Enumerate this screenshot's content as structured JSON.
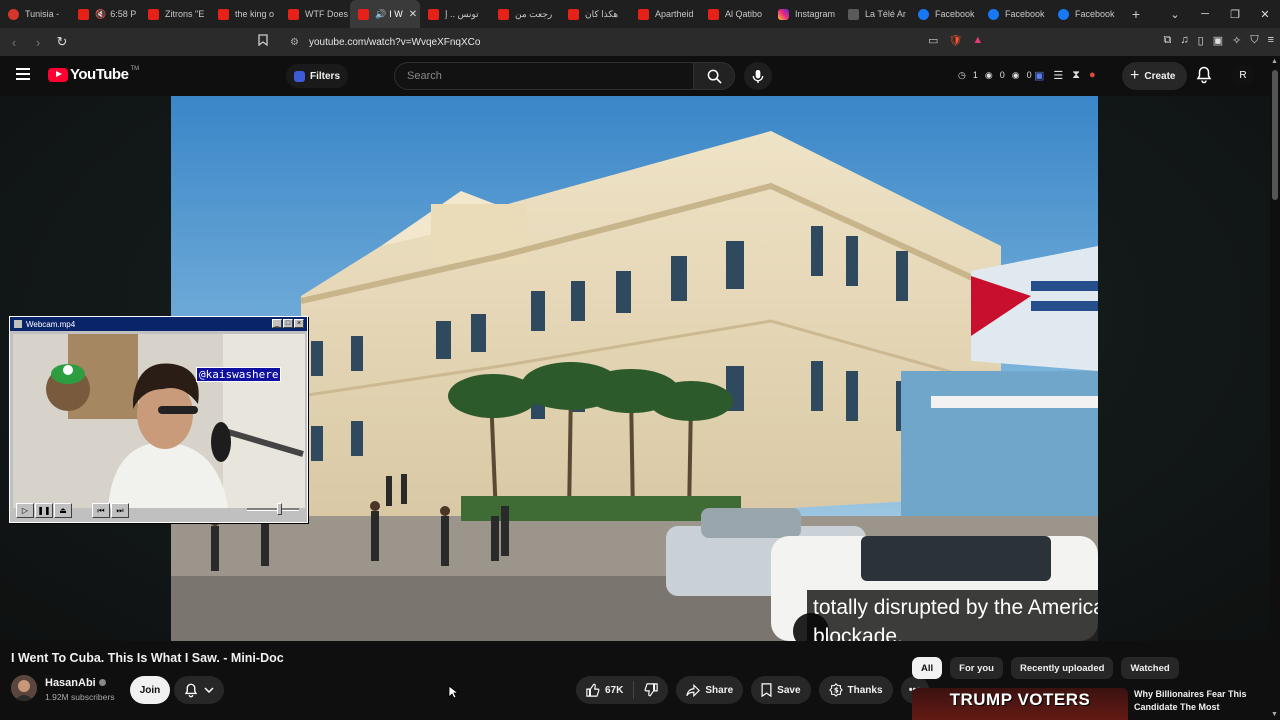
{
  "browser": {
    "tabs": [
      {
        "label": "Tunisia -",
        "icon": "red-circle",
        "active": false
      },
      {
        "label": "6:58 P",
        "icon": "youtube",
        "muted": true,
        "active": false
      },
      {
        "label": "Zitrons \"E",
        "icon": "youtube",
        "active": false
      },
      {
        "label": "the king o",
        "icon": "youtube",
        "active": false
      },
      {
        "label": "WTF Does",
        "icon": "youtube",
        "active": false
      },
      {
        "label": "I W",
        "icon": "youtube",
        "audio": true,
        "active": true
      },
      {
        "label": "تونس .. إ",
        "icon": "youtube",
        "active": false
      },
      {
        "label": "رجعت من",
        "icon": "youtube",
        "active": false
      },
      {
        "label": "هكذا كان",
        "icon": "youtube",
        "active": false
      },
      {
        "label": "Apartheid",
        "icon": "youtube",
        "active": false
      },
      {
        "label": "Al Qatibo",
        "icon": "youtube",
        "active": false
      },
      {
        "label": "Instagram",
        "icon": "instagram",
        "active": false
      },
      {
        "label": "La Télé Ar",
        "icon": "gray",
        "active": false
      },
      {
        "label": "Facebook",
        "icon": "facebook",
        "active": false
      },
      {
        "label": "Facebook",
        "icon": "facebook",
        "active": false
      },
      {
        "label": "Facebook",
        "icon": "facebook",
        "active": false
      }
    ],
    "new_tab": "+",
    "url": "youtube.com/watch?v=WvqeXFnqXCo"
  },
  "youtube": {
    "logo_text": "YouTube",
    "logo_tm": "TM",
    "filters_label": "Filters",
    "search_placeholder": "Search",
    "stats": [
      "1",
      "0",
      "0"
    ],
    "create_label": "Create",
    "avatar_letter": "R"
  },
  "video": {
    "subtitle_lines": [
      "totally disrupted by the American oil",
      "blockade."
    ],
    "title": "I Went To Cuba. This Is What I Saw. - Mini-Doc",
    "channel": "HasanAbi",
    "subscribers": "1.92M subscribers",
    "join_label": "Join",
    "likes": "67K",
    "share_label": "Share",
    "save_label": "Save",
    "thanks_label": "Thanks"
  },
  "webcam": {
    "title": "Webcam.mp4",
    "handle": "@kaiswashere"
  },
  "sidebar": {
    "chips": [
      "All",
      "For you",
      "Recently uploaded",
      "Watched"
    ],
    "active_chip": "All",
    "rec_thumb_text": "TRUMP VOTERS",
    "rec_title": "Why Billionaires Fear This Candidate The Most"
  },
  "colors": {
    "youtube_red": "#ff0033",
    "background": "#0f0f0f",
    "pill": "#272727"
  }
}
